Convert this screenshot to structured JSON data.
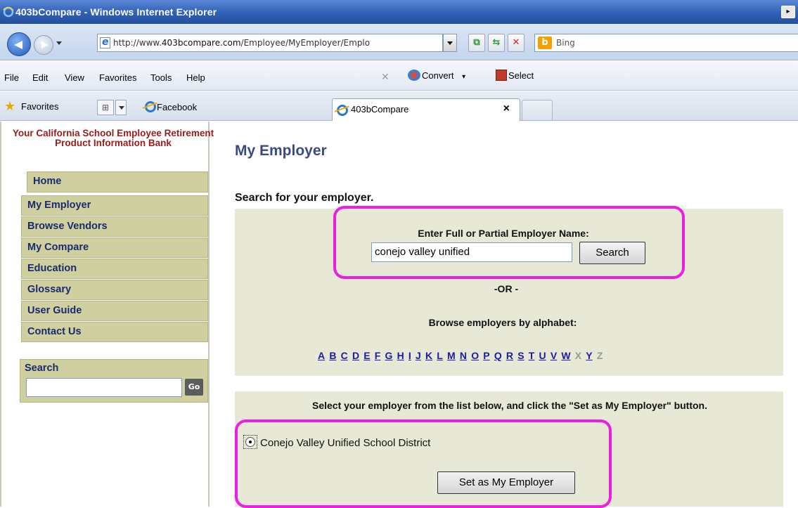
{
  "window": {
    "title": "403bCompare - Windows Internet Explorer",
    "restore_glyph": "▸"
  },
  "address_bar": {
    "url_prefix": "http://www.",
    "url_domain": "403bcompare.com",
    "url_path": "/Employee/MyEmployer/Emplo",
    "search_provider": "Bing"
  },
  "menu": {
    "items": [
      "File",
      "Edit",
      "View",
      "Favorites",
      "Tools",
      "Help"
    ],
    "convert_label": "Convert",
    "select_label": "Select"
  },
  "favorites_bar": {
    "favorites_label": "Favorites",
    "facebook_label": "Facebook",
    "active_tab": "403bCompare",
    "tab_close": "×"
  },
  "sidebar": {
    "tagline": "Your California School Employee Retirement Product Information Bank",
    "home": "Home",
    "nav_items": [
      "My Employer",
      "Browse Vendors",
      "My Compare",
      "Education",
      "Glossary",
      "User Guide",
      "Contact Us"
    ],
    "search_label": "Search",
    "go_label": "Go"
  },
  "main": {
    "page_title": "My Employer",
    "search_heading": "Search for your employer.",
    "name_label": "Enter Full or Partial Employer Name:",
    "name_value": "conejo valley unified",
    "search_button": "Search",
    "or_text": "-OR -",
    "browse_label": "Browse employers by alphabet:",
    "alphabet": [
      {
        "letter": "A",
        "enabled": true
      },
      {
        "letter": "B",
        "enabled": true
      },
      {
        "letter": "C",
        "enabled": true
      },
      {
        "letter": "D",
        "enabled": true
      },
      {
        "letter": "E",
        "enabled": true
      },
      {
        "letter": "F",
        "enabled": true
      },
      {
        "letter": "G",
        "enabled": true
      },
      {
        "letter": "H",
        "enabled": true
      },
      {
        "letter": "I",
        "enabled": true
      },
      {
        "letter": "J",
        "enabled": true
      },
      {
        "letter": "K",
        "enabled": true
      },
      {
        "letter": "L",
        "enabled": true
      },
      {
        "letter": "M",
        "enabled": true
      },
      {
        "letter": "N",
        "enabled": true
      },
      {
        "letter": "O",
        "enabled": true
      },
      {
        "letter": "P",
        "enabled": true
      },
      {
        "letter": "Q",
        "enabled": true
      },
      {
        "letter": "R",
        "enabled": true
      },
      {
        "letter": "S",
        "enabled": true
      },
      {
        "letter": "T",
        "enabled": true
      },
      {
        "letter": "U",
        "enabled": true
      },
      {
        "letter": "V",
        "enabled": true
      },
      {
        "letter": "W",
        "enabled": true
      },
      {
        "letter": "X",
        "enabled": false
      },
      {
        "letter": "Y",
        "enabled": true
      },
      {
        "letter": "Z",
        "enabled": false
      }
    ],
    "select_instruction": "Select your employer from the list below, and click the \"Set as My Employer\" button.",
    "employer_option": "Conejo Valley Unified School District",
    "set_button": "Set as My Employer"
  },
  "colors": {
    "highlight": "#ee1ee0",
    "nav_bg": "#cfcfa0",
    "panel_bg": "#e8e8d6",
    "title_color": "#3a4a86",
    "tagline_color": "#9b1b1b"
  }
}
